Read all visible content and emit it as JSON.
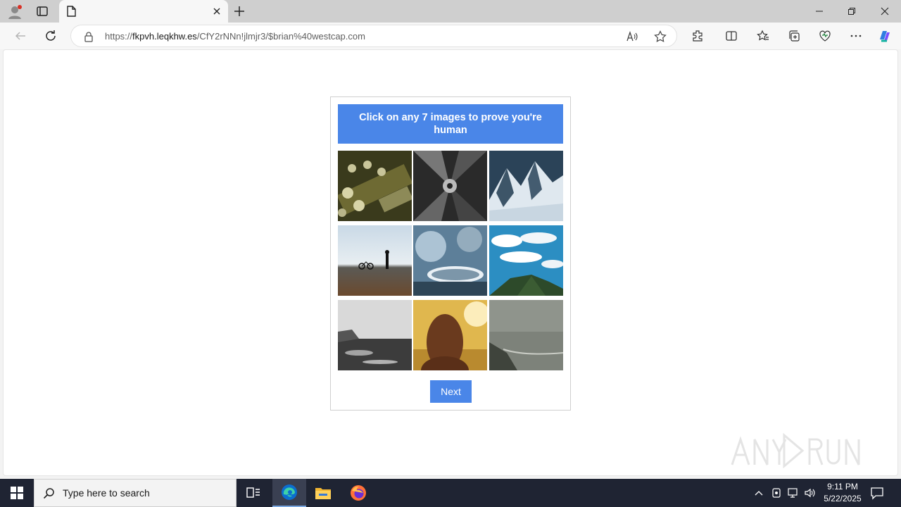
{
  "browser": {
    "url_prefix": "https://",
    "url_domain": "fkpvh.leqkhw.es",
    "url_path": "/CfY2rNNn!jlmjr3/$brian%40westcap.com"
  },
  "captcha": {
    "header": "Click on any 7 images to prove you're human",
    "next_label": "Next",
    "images": [
      {
        "subject": "guitar-headstock"
      },
      {
        "subject": "building-looking-up"
      },
      {
        "subject": "snowy-mountains"
      },
      {
        "subject": "beach-silhouette"
      },
      {
        "subject": "blurred-glass-cup"
      },
      {
        "subject": "cloudy-hilltop"
      },
      {
        "subject": "foggy-shoreline"
      },
      {
        "subject": "woman-in-field"
      },
      {
        "subject": "misty-coast"
      }
    ]
  },
  "watermark": {
    "text": "ANY RUN"
  },
  "taskbar": {
    "search_placeholder": "Type here to search",
    "time": "9:11 PM",
    "date": "5/22/2025"
  },
  "colors": {
    "accent": "#4a86e8",
    "taskbar": "#1f2433"
  }
}
